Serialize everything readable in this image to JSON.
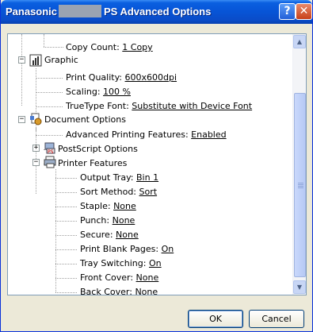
{
  "window": {
    "title_left": "Panasonic",
    "title_right": "PS Advanced Options",
    "help_glyph": "?",
    "close_glyph": "✕"
  },
  "tree": {
    "copy_count": {
      "label": "Copy Count:",
      "value": "1 Copy"
    },
    "graphic": {
      "label": "Graphic"
    },
    "print_quality": {
      "label": "Print Quality:",
      "value": "600x600dpi"
    },
    "scaling": {
      "label": "Scaling:",
      "value": "100 %"
    },
    "truetype_font": {
      "label": "TrueType Font:",
      "value": "Substitute with Device Font"
    },
    "document_options": {
      "label": "Document Options"
    },
    "advanced_printing": {
      "label": "Advanced Printing Features:",
      "value": "Enabled"
    },
    "postscript_options": {
      "label": "PostScript Options"
    },
    "printer_features": {
      "label": "Printer Features"
    },
    "output_tray": {
      "label": "Output Tray:",
      "value": "Bin 1"
    },
    "sort_method": {
      "label": "Sort Method:",
      "value": "Sort"
    },
    "staple": {
      "label": "Staple:",
      "value": "None"
    },
    "punch": {
      "label": "Punch:",
      "value": "None"
    },
    "secure": {
      "label": "Secure:",
      "value": "None"
    },
    "print_blank_pages": {
      "label": "Print Blank Pages:",
      "value": "On"
    },
    "tray_switching": {
      "label": "Tray Switching:",
      "value": "On"
    },
    "front_cover": {
      "label": "Front Cover:",
      "value": "None"
    },
    "back_cover": {
      "label": "Back Cover:",
      "value": "None"
    },
    "expand_glyph": "+",
    "collapse_glyph": "−"
  },
  "buttons": {
    "ok": "OK",
    "cancel": "Cancel"
  },
  "colors": {
    "titlebar": "#0754d6",
    "dialog_bg": "#ece9d8",
    "border": "#7f9db9"
  }
}
